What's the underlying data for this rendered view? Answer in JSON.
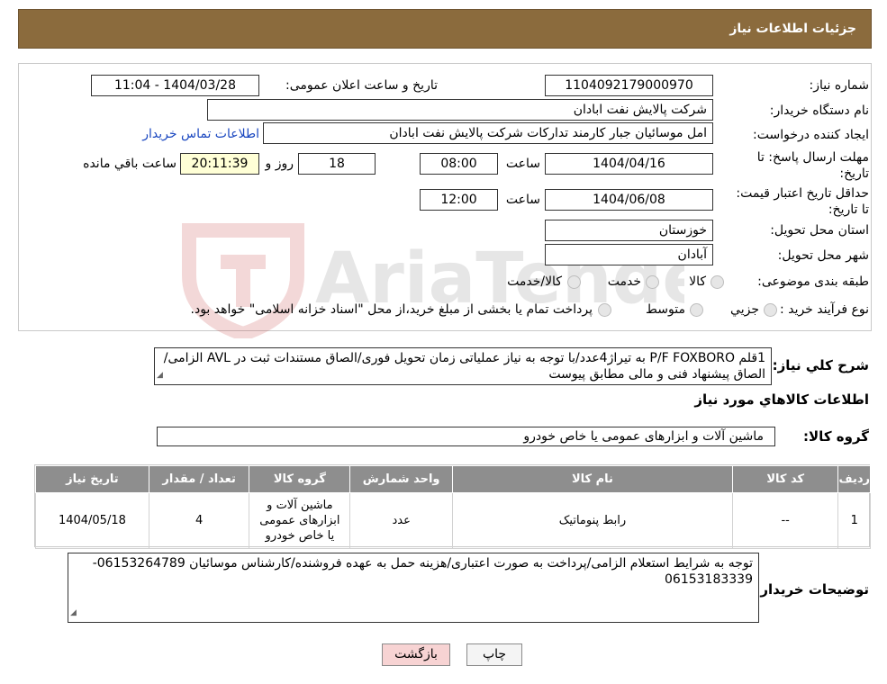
{
  "header": {
    "title": "جزئیات اطلاعات نیاز"
  },
  "watermark": {
    "text": "AriaTender.neT"
  },
  "form": {
    "need_number": {
      "label": "شماره نیاز:",
      "value": "1104092179000970"
    },
    "announce_datetime": {
      "label": "تاریخ و ساعت اعلان عمومی:",
      "value": "1404/03/28 - 11:04"
    },
    "buyer_org": {
      "label": "نام دستگاه خریدار:",
      "value": "شرکت پالایش نفت ابادان"
    },
    "creator": {
      "label": "ایجاد کننده درخواست:",
      "value": "امل موسائیان جبار کارمند تدارکات شرکت پالایش نفت ابادان",
      "contact_link": "اطلاعات تماس خریدار"
    },
    "reply_deadline": {
      "label": "مهلت ارسال پاسخ: تا تاریخ:",
      "date": "1404/04/16",
      "time_label": "ساعت",
      "time": "08:00",
      "days": "18",
      "days_label": "روز و",
      "remaining": "20:11:39",
      "remaining_label": "ساعت باقي مانده"
    },
    "price_validity": {
      "label": "حداقل تاریخ اعتبار قیمت: تا تاریخ:",
      "date": "1404/06/08",
      "time_label": "ساعت",
      "time": "12:00"
    },
    "province": {
      "label": "استان محل تحویل:",
      "value": "خوزستان"
    },
    "city": {
      "label": "شهر محل تحویل:",
      "value": "آبادان"
    },
    "category": {
      "label": "طبقه بندی موضوعی:",
      "options": [
        "کالا",
        "خدمت",
        "کالا/خدمت"
      ]
    },
    "purchase_type": {
      "label": "نوع فرآیند خرید :",
      "options": [
        "جزیي",
        "متوسط"
      ],
      "note": "پرداخت تمام یا بخشی از مبلغ خرید،از محل \"اسناد خزانه اسلامی\" خواهد بود."
    }
  },
  "description": {
    "label": "شرح کلي نياز:",
    "text": "1قلم  P/F FOXBORO به تیراژ4عدد/با توجه به نیاز عملیاتی زمان تحویل فوری/الصاق مستندات ثبت در AVL الزامی/الصاق پیشنهاد فنی و مالی مطابق پیوست"
  },
  "goods_section": {
    "title": "اطلاعات کالاهاي مورد نياز"
  },
  "goods_group": {
    "label": "گروه کالا:",
    "value": "ماشین آلات و ابزارهای عمومی یا خاص خودرو"
  },
  "table": {
    "headers": [
      "رديف",
      "کد کالا",
      "نام کالا",
      "واحد شمارش",
      "گروه کالا",
      "تعداد / مقدار",
      "تاريخ نياز"
    ],
    "rows": [
      [
        "1",
        "--",
        "رابط پنوماتیک",
        "عدد",
        "ماشین آلات و ابزارهای عمومی یا خاص خودرو",
        "4",
        "1404/05/18"
      ]
    ]
  },
  "buyer_notes": {
    "label": "توضيحات خريدار:",
    "text": "توجه به شرایط استعلام الزامی/پرداخت به صورت اعتباری/هزینه حمل به عهده فروشنده/کارشناس موسائیان 06153264789-06153183339"
  },
  "buttons": {
    "print": "چاپ",
    "back": "بازگشت"
  },
  "colors": {
    "header": "#8b6b3d",
    "table_header": "#8e8e8e",
    "back_button": "#f7d3d3",
    "remaining_box": "#ffffd6",
    "link": "#1a47c0"
  }
}
